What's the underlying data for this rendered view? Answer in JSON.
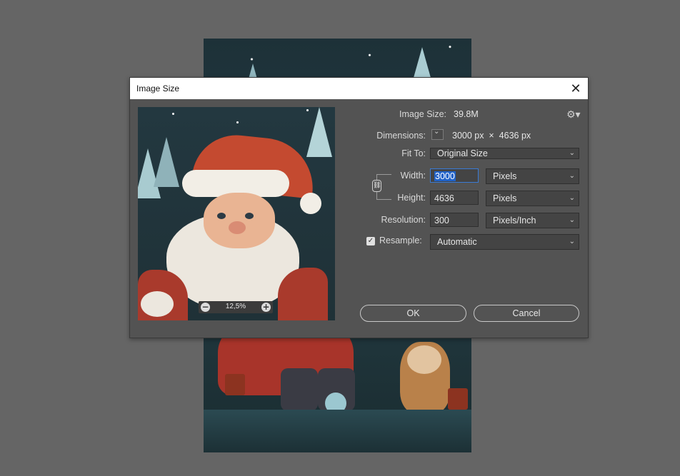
{
  "dialog": {
    "title": "Image Size",
    "close_glyph": "✕"
  },
  "preview": {
    "zoom_level": "12,5%",
    "zoom_out_glyph": "−",
    "zoom_in_glyph": "+"
  },
  "form": {
    "image_size_label": "Image Size:",
    "image_size_value": "39.8M",
    "dimensions_label": "Dimensions:",
    "dimensions_value": "3000 px  ×  4636 px",
    "fit_to_label": "Fit To:",
    "fit_to_value": "Original Size",
    "width_label": "Width:",
    "width_value": "3000",
    "width_unit": "Pixels",
    "height_label": "Height:",
    "height_value": "4636",
    "height_unit": "Pixels",
    "resolution_label": "Resolution:",
    "resolution_value": "300",
    "resolution_unit": "Pixels/Inch",
    "resample_label": "Resample:",
    "resample_checked": true,
    "resample_value": "Automatic"
  },
  "buttons": {
    "ok_label": "OK",
    "cancel_label": "Cancel"
  },
  "icons": {
    "gear": "gear-icon",
    "link": "chain-link-icon",
    "chevron": "chevron-down-icon",
    "close": "close-icon"
  }
}
